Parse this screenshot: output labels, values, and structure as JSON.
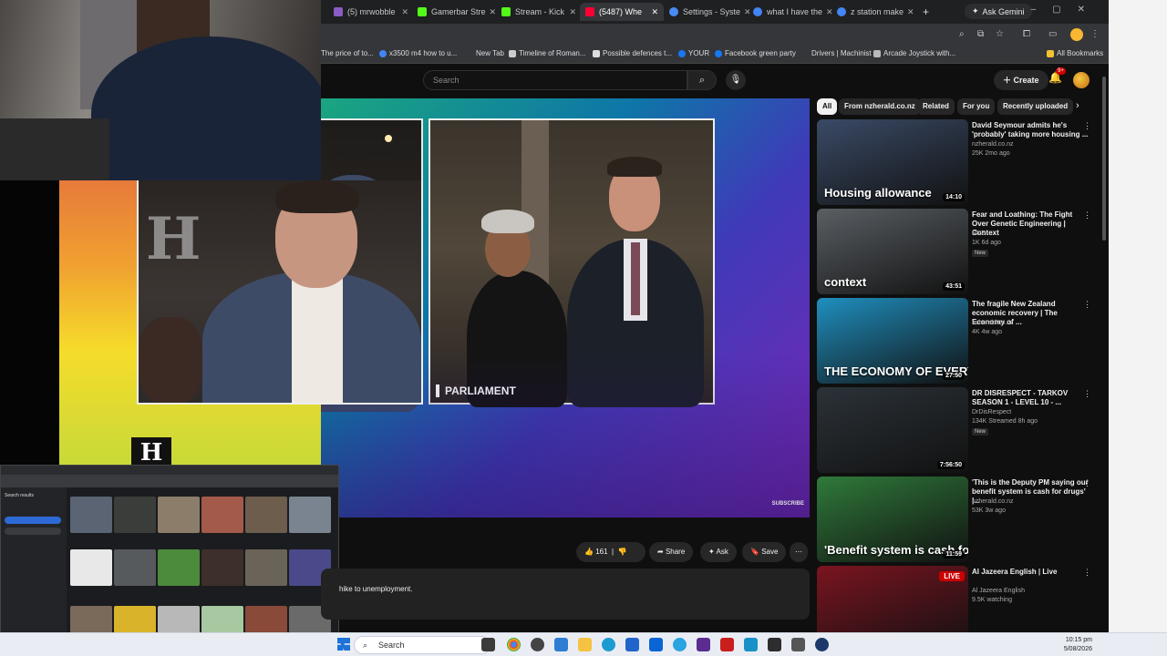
{
  "browser": {
    "tabs": [
      {
        "label": "(5) mrwobble",
        "color": "#8a5cc4"
      },
      {
        "label": "Gamerbar Stre",
        "color": "#53fc18"
      },
      {
        "label": "Stream - Kick",
        "color": "#53fc18"
      },
      {
        "label": "(5487) Whe",
        "color": "#ff0033",
        "active": true
      },
      {
        "label": "Settings - Syste",
        "color": "#4a8af4"
      },
      {
        "label": "what I have the",
        "color": "#4285f4"
      },
      {
        "label": "z station make",
        "color": "#4285f4"
      }
    ],
    "ask_gemini": "Ask Gemini",
    "all_bookmarks": "All Bookmarks",
    "bookmarks": [
      {
        "label": "The price of to...",
        "color": ""
      },
      {
        "label": "x3500 m4 how to u...",
        "color": "#4285f4"
      },
      {
        "label": "New Tab",
        "color": ""
      },
      {
        "label": "Timeline of Roman...",
        "color": "#ccc"
      },
      {
        "label": "Possible defences t...",
        "color": "#ddd"
      },
      {
        "label": "YOUR",
        "color": "#1877f2"
      },
      {
        "label": "Facebook green party",
        "color": "#1877f2"
      },
      {
        "label": "Drivers | Machinist",
        "color": ""
      },
      {
        "label": "Arcade Joystick with...",
        "color": "#bbb"
      }
    ]
  },
  "youtube": {
    "search_placeholder": "Search",
    "create_label": "Create",
    "notification_count": "9+",
    "video": {
      "lower_third": "PARLIAMENT",
      "subscribe_text": "SUBSCRIBE",
      "logo_letter": "H"
    },
    "actions": {
      "likes": "161",
      "share": "Share",
      "ask": "Ask",
      "save": "Save"
    },
    "description_snippet": "hike to unemployment.",
    "chips": [
      "All",
      "From nzherald.co.nz",
      "Related",
      "For you",
      "Recently uploaded"
    ],
    "recommendations": [
      {
        "title": "David Seymour admits he's 'probably' taking more housing ...",
        "channel": "nzherald.co.nz",
        "meta": "25K  2mo ago",
        "duration": "14:10",
        "overlay": "Housing allowance",
        "live": false,
        "new": false,
        "bg": "#3a4a66"
      },
      {
        "title": "Fear and Loathing: The Fight Over Genetic Engineering | Context",
        "channel": "RNZ",
        "meta": "1K  6d ago",
        "duration": "43:51",
        "overlay": "context",
        "live": false,
        "new": true,
        "bg": "#5a5f64"
      },
      {
        "title": "The fragile New Zealand economic recovery | The Economy of ...",
        "channel": "nzherald.co.nz",
        "meta": "4K  4w ago",
        "duration": "27:50",
        "overlay": "THE ECONOMY OF EVERYTHING",
        "live": false,
        "new": false,
        "bg": "#1f8fbf"
      },
      {
        "title": "DR DISRESPECT - TARKOV SEASON 1 - LEVEL 10 - ...",
        "channel": "DrDisRespect",
        "meta": "134K  Streamed 8h ago",
        "duration": "7:56:50",
        "overlay": "",
        "live": false,
        "new": true,
        "bg": "#2b3238"
      },
      {
        "title": "'This is the Deputy PM saying our benefit system is cash for drugs' |...",
        "channel": "nzherald.co.nz",
        "meta": "53K  3w ago",
        "duration": "11:59",
        "overlay": "'Benefit system is cash for drugs'",
        "live": false,
        "new": false,
        "bg": "#2f7a3a"
      },
      {
        "title": "Al Jazeera English | Live",
        "channel": "Al Jazeera English",
        "meta": "9.5K watching",
        "duration": "",
        "overlay": "",
        "live": true,
        "new": false,
        "bg": "#7a1420"
      }
    ],
    "live_badge": "LIVE"
  },
  "overlay": {
    "fb_search_title": "Search results"
  },
  "taskbar": {
    "search_label": "Search",
    "time": "10:15 pm",
    "date": "5/08/2026"
  }
}
